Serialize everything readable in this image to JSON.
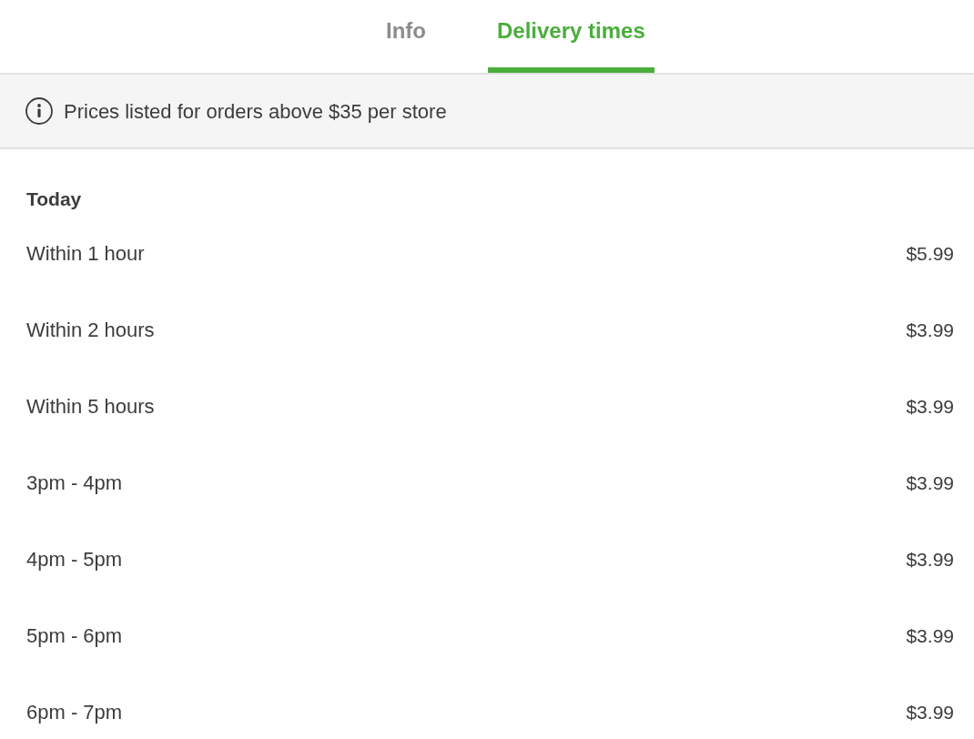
{
  "tabs": [
    {
      "label": "Info",
      "selected": false
    },
    {
      "label": "Delivery times",
      "selected": true
    }
  ],
  "notice": {
    "text": "Prices listed for orders above $35 per store"
  },
  "schedule": {
    "day": "Today",
    "slots": [
      {
        "time": "Within 1 hour",
        "price": "$5.99"
      },
      {
        "time": "Within 2 hours",
        "price": "$3.99"
      },
      {
        "time": "Within 5 hours",
        "price": "$3.99"
      },
      {
        "time": "3pm - 4pm",
        "price": "$3.99"
      },
      {
        "time": "4pm - 5pm",
        "price": "$3.99"
      },
      {
        "time": "5pm - 6pm",
        "price": "$3.99"
      },
      {
        "time": "6pm - 7pm",
        "price": "$3.99"
      }
    ]
  }
}
